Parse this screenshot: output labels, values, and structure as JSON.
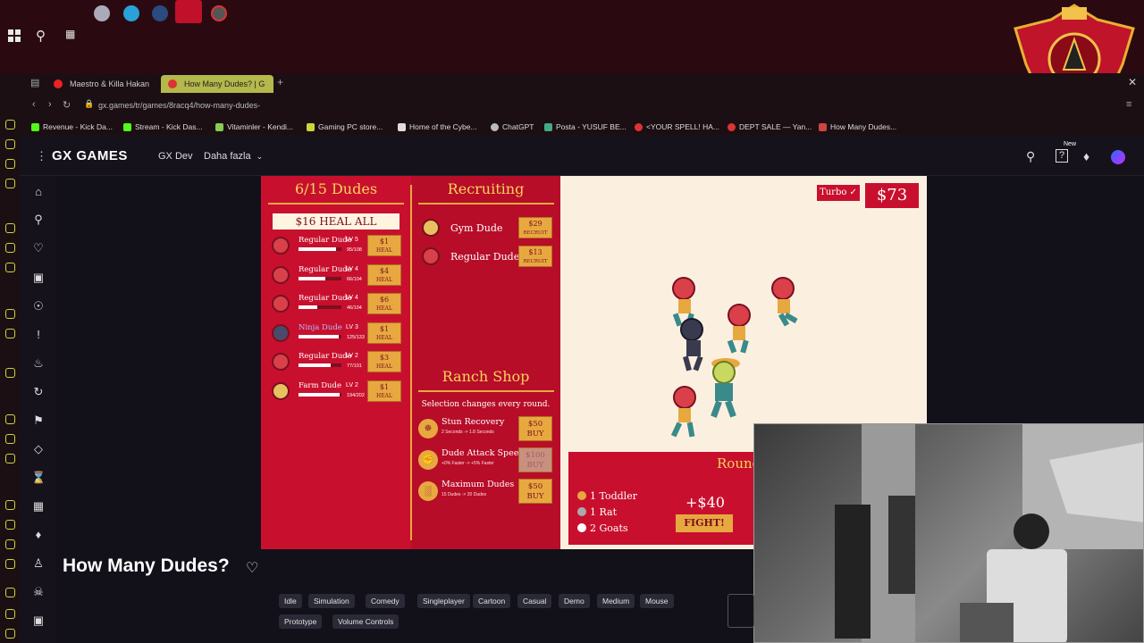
{
  "browser": {
    "tabs": [
      {
        "label": "Maestro & Killa Hakan"
      },
      {
        "label": "How Many Dudes? | G"
      }
    ],
    "url": "gx.games/tr/games/8racq4/how-many-dudes-",
    "bookmarks": [
      "Revenue - Kick Da...",
      "Stream - Kick Das...",
      "Vitaminler - Kendi...",
      "Gaming PC store...",
      "Home of the Cybe...",
      "ChatGPT",
      "Posta - YUSUF BE...",
      "<YOUR SPELL! HA...",
      "DEPT SALE — Yan...",
      "How Many Dudes..."
    ]
  },
  "gx": {
    "logo": "GX GAMES",
    "nav": {
      "dev": "GX Dev",
      "more": "Daha fazla"
    },
    "new_badge": "New"
  },
  "game": {
    "dudes_title": "6/15 Dudes",
    "heal_all": "$16 HEAL ALL",
    "dudes": [
      {
        "name": "Regular Dude",
        "lv": "LV 5",
        "hp": "95/108",
        "hp_frac": 0.88,
        "cost": "$1",
        "action": "HEAL",
        "type": "regular"
      },
      {
        "name": "Regular Dude",
        "lv": "LV 4",
        "hp": "66/104",
        "hp_frac": 0.63,
        "cost": "$4",
        "action": "HEAL",
        "type": "regular"
      },
      {
        "name": "Regular Dude",
        "lv": "LV 4",
        "hp": "46/104",
        "hp_frac": 0.44,
        "cost": "$6",
        "action": "HEAL",
        "type": "regular"
      },
      {
        "name": "Ninja Dude",
        "lv": "LV 3",
        "hp": "125/133",
        "hp_frac": 0.94,
        "cost": "$1",
        "action": "HEAL",
        "type": "ninja"
      },
      {
        "name": "Regular Dude",
        "lv": "LV 2",
        "hp": "77/101",
        "hp_frac": 0.76,
        "cost": "$3",
        "action": "HEAL",
        "type": "regular"
      },
      {
        "name": "Farm Dude",
        "lv": "LV 2",
        "hp": "194/202",
        "hp_frac": 0.96,
        "cost": "$1",
        "action": "HEAL",
        "type": "farm"
      }
    ],
    "recruiting_title": "Recruiting",
    "recruits": [
      {
        "name": "Gym Dude",
        "cost": "$29",
        "action": "RECRUIT"
      },
      {
        "name": "Regular Dude",
        "cost": "$13",
        "action": "RECRUIT"
      }
    ],
    "shop_title": "Ranch Shop",
    "shop_note": "Selection changes every round.",
    "shop_items": [
      {
        "name": "Stun Recovery",
        "desc": "2 Seconds -> 1.8 Seconds",
        "cost": "$50",
        "action": "BUY",
        "disabled": false
      },
      {
        "name": "Dude Attack Speed",
        "desc": "+0% Faster -> +5% Faster",
        "cost": "$100",
        "action": "BUY",
        "disabled": true
      },
      {
        "name": "Maximum Dudes",
        "desc": "15 Dudes -> 20 Dudes",
        "cost": "$50",
        "action": "BUY",
        "disabled": false
      }
    ],
    "turbo": "Turbo ✓",
    "money": "$73",
    "round_title": "Round",
    "enemies": [
      "1 Toddler",
      "1 Rat",
      "2 Goats"
    ],
    "reward": "+$40",
    "fight": "FIGHT!"
  },
  "page": {
    "title": "How Many Dudes?",
    "tags": [
      "Idle",
      "Simulation",
      "Comedy",
      "Singleplayer",
      "Cartoon",
      "Casual",
      "Demo",
      "Medium",
      "Mouse",
      "Prototype",
      "Volume Controls"
    ]
  }
}
